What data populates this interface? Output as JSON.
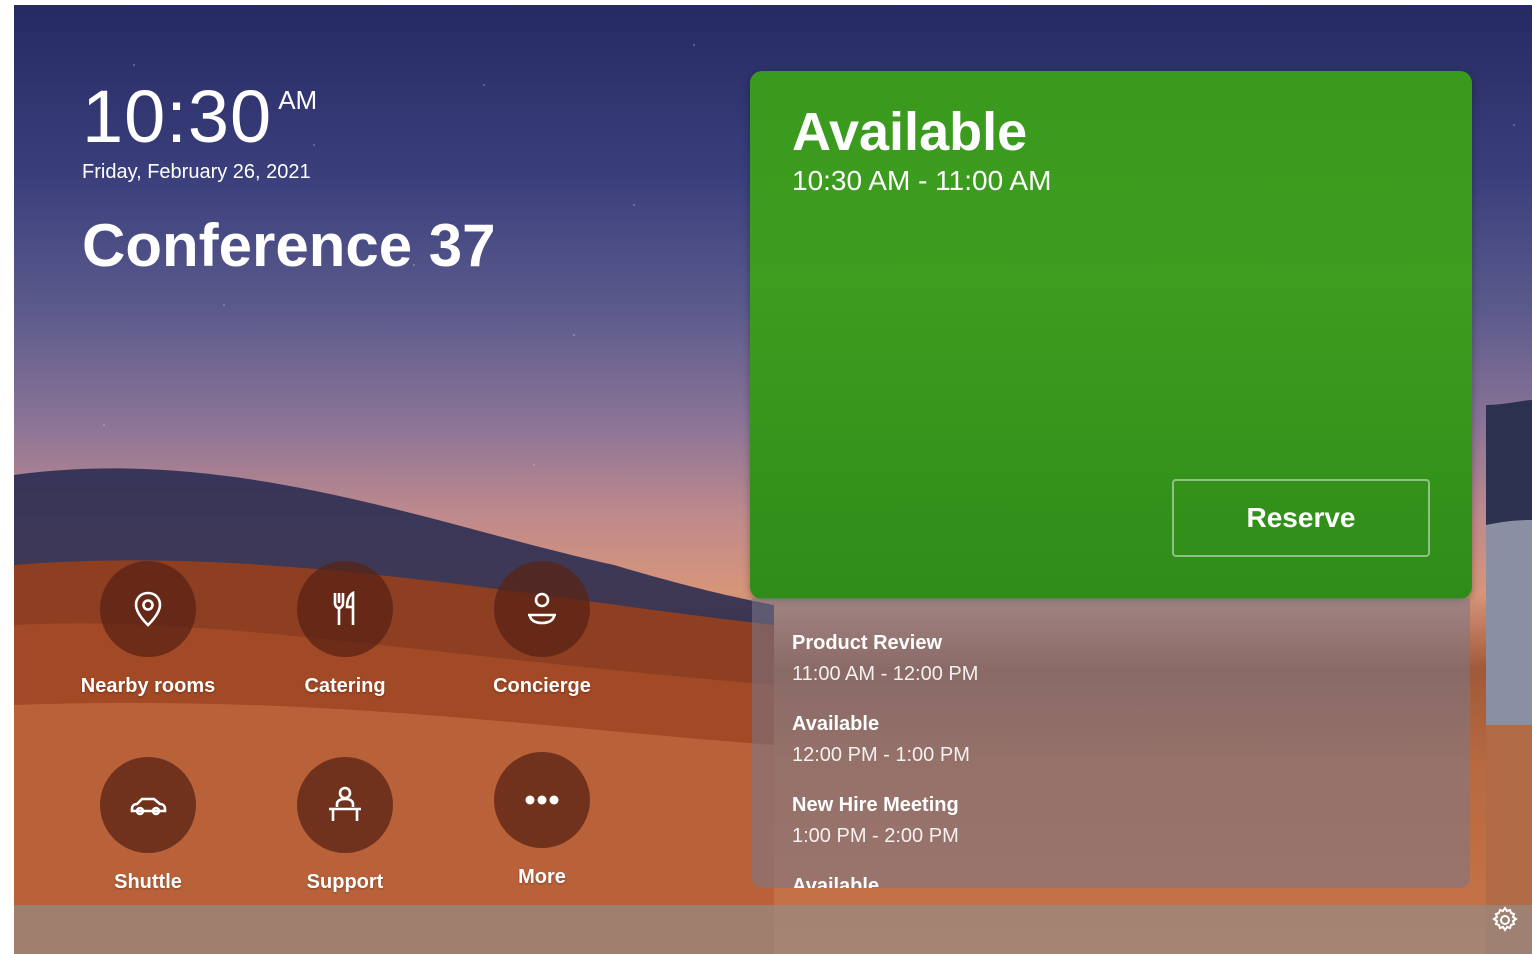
{
  "clock": {
    "time": "10:30",
    "ampm": "AM",
    "date": "Friday, February 26, 2021"
  },
  "room": {
    "name": "Conference 37"
  },
  "tiles": [
    {
      "label": "Nearby rooms",
      "icon": "location-pin-icon"
    },
    {
      "label": "Catering",
      "icon": "fork-knife-icon"
    },
    {
      "label": "Concierge",
      "icon": "concierge-icon"
    },
    {
      "label": "Shuttle",
      "icon": "car-icon"
    },
    {
      "label": "Support",
      "icon": "support-desk-icon"
    },
    {
      "label": "More",
      "icon": "more-dots-icon"
    }
  ],
  "status": {
    "label": "Available",
    "range": "10:30 AM - 11:00 AM",
    "reserve_label": "Reserve",
    "color": "#3a9a1e"
  },
  "schedule": [
    {
      "title": "Product Review",
      "range": "11:00 AM - 12:00 PM"
    },
    {
      "title": "Available",
      "range": "12:00 PM - 1:00 PM"
    },
    {
      "title": "New Hire Meeting",
      "range": "1:00 PM - 2:00 PM"
    },
    {
      "title": "Available",
      "range": ""
    }
  ],
  "settings": {
    "icon": "gear-icon"
  }
}
